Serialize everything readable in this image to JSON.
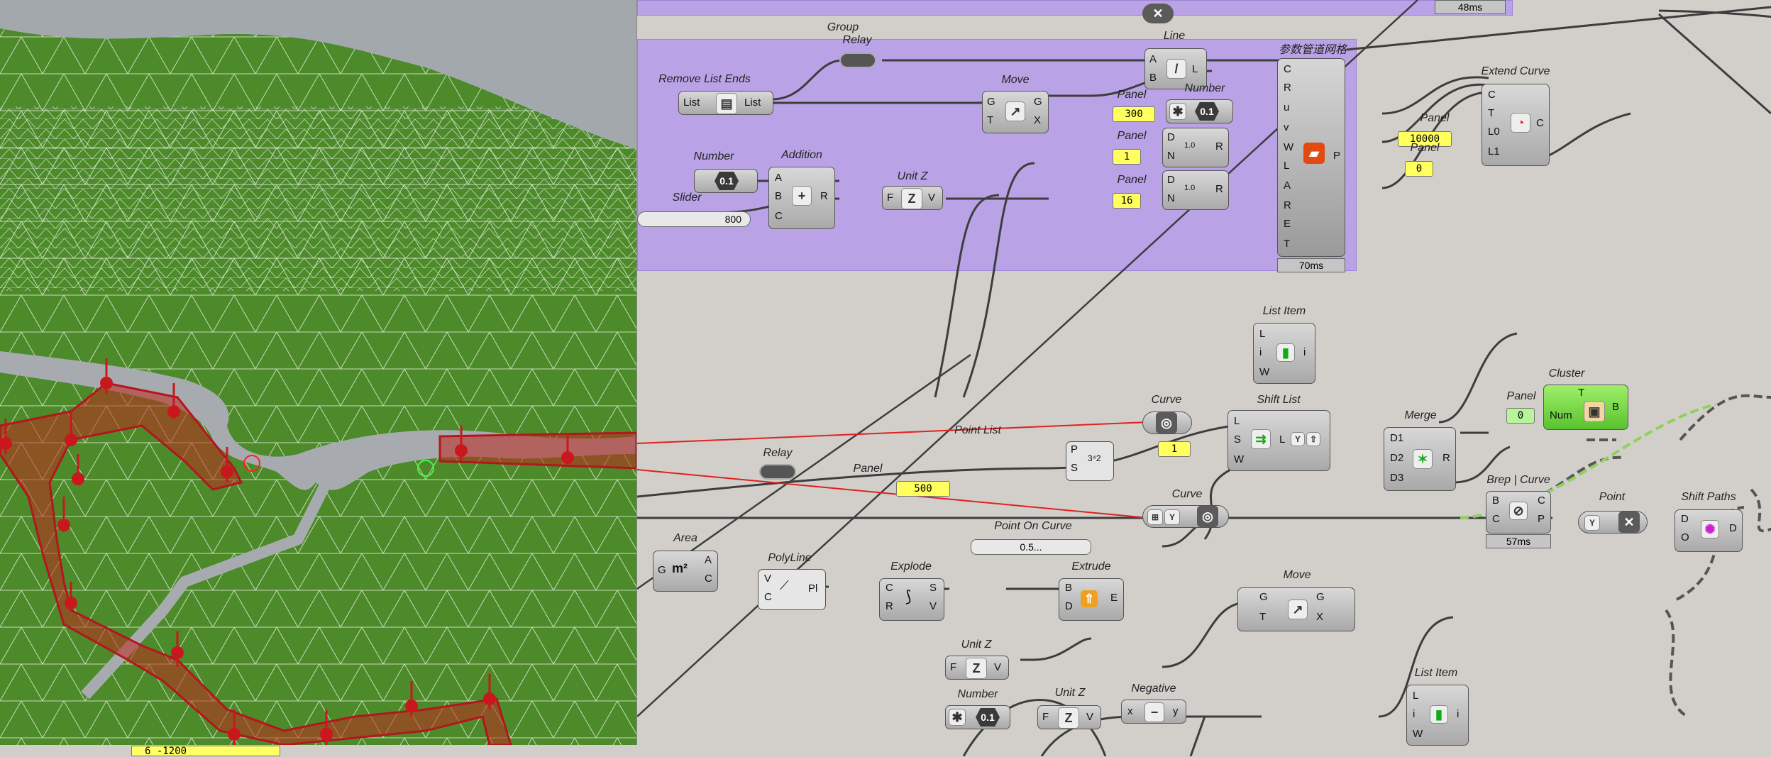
{
  "viewport": {
    "status_text": "6 -1200"
  },
  "toolbar": {
    "icons": [
      "grid-icon",
      "sphere-icon",
      "line-icon",
      "cube-icon",
      "rotate-icon",
      "scale-icon",
      "points-icon",
      "transform-icon"
    ]
  },
  "groups": {
    "top_timing": "48ms"
  },
  "components": {
    "group_relay": {
      "title": "Group",
      "sub": "Relay"
    },
    "remove_list_ends": {
      "title": "Remove List Ends",
      "in": "List",
      "out": "List"
    },
    "number1": {
      "title": "Number",
      "value": "0.1"
    },
    "addition": {
      "title": "Addition",
      "ports_in": [
        "A",
        "B",
        "C"
      ],
      "port_out": "R"
    },
    "slider": {
      "title": "Slider",
      "value": "800"
    },
    "unit_z_top": {
      "title": "Unit Z",
      "in": "F",
      "out": "V"
    },
    "move_top": {
      "title": "Move",
      "in": [
        "G",
        "T"
      ],
      "out": [
        "G",
        "X"
      ]
    },
    "line": {
      "title": "Line",
      "in": [
        "A",
        "B"
      ],
      "out": "L"
    },
    "number2": {
      "title": "Number",
      "value": "0.1"
    },
    "panels_top": [
      "300",
      "1",
      "16"
    ],
    "panel_label": "Panel",
    "series_a": {
      "in": [
        "D",
        "N"
      ],
      "out": "R",
      "value": "1.0"
    },
    "pipe_grid": {
      "title": "参数管道网格",
      "ports": [
        "C",
        "R",
        "u",
        "v",
        "W",
        "L",
        "A",
        "R",
        "E",
        "T"
      ],
      "out": "P",
      "timing": "70ms"
    },
    "extend_curve": {
      "title": "Extend Curve",
      "ports": [
        "C",
        "T",
        "L0",
        "L1"
      ],
      "out": "C"
    },
    "panel_10000": "10000",
    "panel_0": "0",
    "list_item1": {
      "title": "List Item",
      "ports": [
        "L",
        "i",
        "W"
      ],
      "out": "i"
    },
    "shift_list": {
      "title": "Shift List",
      "ports": [
        "L",
        "S",
        "W"
      ],
      "out": "L"
    },
    "panel_1": "1",
    "curve1": {
      "title": "Curve"
    },
    "merge": {
      "title": "Merge",
      "ports": [
        "D1",
        "D2",
        "D3"
      ],
      "out": "R"
    },
    "cluster": {
      "title": "Cluster",
      "in": "Num",
      "out": "B",
      "top": "T"
    },
    "panel_cluster": {
      "title": "Panel",
      "value": "0"
    },
    "relay2": {
      "title": "Relay"
    },
    "panel_500": {
      "title": "Panel",
      "value": "500"
    },
    "point_list": {
      "title": "Point List",
      "ports": [
        "P",
        "S"
      ]
    },
    "curve2": {
      "title": "Curve"
    },
    "brep_curve": {
      "title": "Brep | Curve",
      "ports": [
        "B",
        "C"
      ],
      "out": [
        "C",
        "P"
      ],
      "timing": "57ms"
    },
    "point": {
      "title": "Point"
    },
    "shift_paths": {
      "title": "Shift Paths",
      "ports": [
        "D",
        "O"
      ],
      "out": "D"
    },
    "area": {
      "title": "Area",
      "in": "G",
      "out": [
        "A",
        "C"
      ]
    },
    "polyline": {
      "title": "PolyLine",
      "in": [
        "V",
        "C"
      ],
      "out": "Pl"
    },
    "explode": {
      "title": "Explode",
      "in": [
        "C",
        "R"
      ],
      "out": [
        "S",
        "V"
      ]
    },
    "point_on_curve": {
      "title": "Point On Curve",
      "value": "0.5..."
    },
    "extrude": {
      "title": "Extrude",
      "in": [
        "B",
        "D"
      ],
      "out": "E"
    },
    "move_bottom": {
      "title": "Move",
      "in": [
        "G",
        "T"
      ],
      "out": [
        "G",
        "X"
      ]
    },
    "unit_z_mid": {
      "title": "Unit Z",
      "in": "F",
      "out": "V"
    },
    "number3": {
      "title": "Number",
      "value": "0.1"
    },
    "unit_z_bottom": {
      "title": "Unit Z",
      "in": "F",
      "out": "V"
    },
    "negative": {
      "title": "Negative",
      "in": "x",
      "out": "y"
    },
    "list_item2": {
      "title": "List Item",
      "ports": [
        "L",
        "i",
        "W"
      ],
      "out": "i"
    }
  }
}
